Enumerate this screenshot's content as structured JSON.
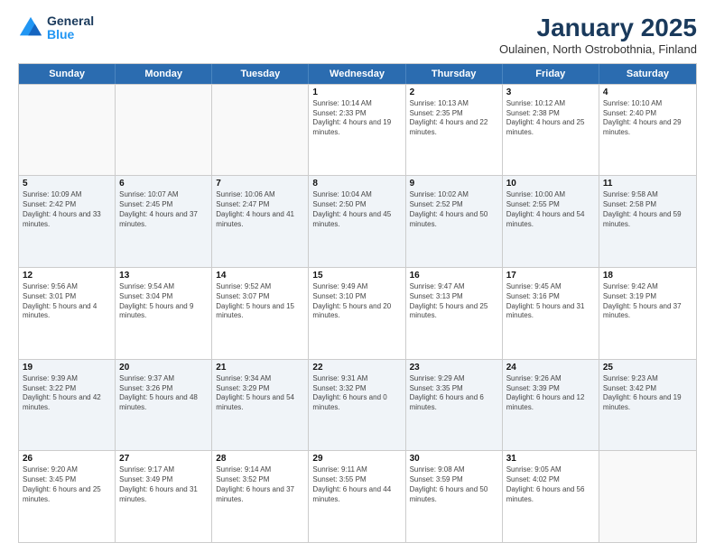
{
  "header": {
    "logo_line1": "General",
    "logo_line2": "Blue",
    "title": "January 2025",
    "subtitle": "Oulainen, North Ostrobothnia, Finland"
  },
  "weekdays": [
    "Sunday",
    "Monday",
    "Tuesday",
    "Wednesday",
    "Thursday",
    "Friday",
    "Saturday"
  ],
  "rows": [
    [
      {
        "day": "",
        "sunrise": "",
        "sunset": "",
        "daylight": "",
        "empty": true
      },
      {
        "day": "",
        "sunrise": "",
        "sunset": "",
        "daylight": "",
        "empty": true
      },
      {
        "day": "",
        "sunrise": "",
        "sunset": "",
        "daylight": "",
        "empty": true
      },
      {
        "day": "1",
        "sunrise": "Sunrise: 10:14 AM",
        "sunset": "Sunset: 2:33 PM",
        "daylight": "Daylight: 4 hours and 19 minutes."
      },
      {
        "day": "2",
        "sunrise": "Sunrise: 10:13 AM",
        "sunset": "Sunset: 2:35 PM",
        "daylight": "Daylight: 4 hours and 22 minutes."
      },
      {
        "day": "3",
        "sunrise": "Sunrise: 10:12 AM",
        "sunset": "Sunset: 2:38 PM",
        "daylight": "Daylight: 4 hours and 25 minutes."
      },
      {
        "day": "4",
        "sunrise": "Sunrise: 10:10 AM",
        "sunset": "Sunset: 2:40 PM",
        "daylight": "Daylight: 4 hours and 29 minutes."
      }
    ],
    [
      {
        "day": "5",
        "sunrise": "Sunrise: 10:09 AM",
        "sunset": "Sunset: 2:42 PM",
        "daylight": "Daylight: 4 hours and 33 minutes."
      },
      {
        "day": "6",
        "sunrise": "Sunrise: 10:07 AM",
        "sunset": "Sunset: 2:45 PM",
        "daylight": "Daylight: 4 hours and 37 minutes."
      },
      {
        "day": "7",
        "sunrise": "Sunrise: 10:06 AM",
        "sunset": "Sunset: 2:47 PM",
        "daylight": "Daylight: 4 hours and 41 minutes."
      },
      {
        "day": "8",
        "sunrise": "Sunrise: 10:04 AM",
        "sunset": "Sunset: 2:50 PM",
        "daylight": "Daylight: 4 hours and 45 minutes."
      },
      {
        "day": "9",
        "sunrise": "Sunrise: 10:02 AM",
        "sunset": "Sunset: 2:52 PM",
        "daylight": "Daylight: 4 hours and 50 minutes."
      },
      {
        "day": "10",
        "sunrise": "Sunrise: 10:00 AM",
        "sunset": "Sunset: 2:55 PM",
        "daylight": "Daylight: 4 hours and 54 minutes."
      },
      {
        "day": "11",
        "sunrise": "Sunrise: 9:58 AM",
        "sunset": "Sunset: 2:58 PM",
        "daylight": "Daylight: 4 hours and 59 minutes."
      }
    ],
    [
      {
        "day": "12",
        "sunrise": "Sunrise: 9:56 AM",
        "sunset": "Sunset: 3:01 PM",
        "daylight": "Daylight: 5 hours and 4 minutes."
      },
      {
        "day": "13",
        "sunrise": "Sunrise: 9:54 AM",
        "sunset": "Sunset: 3:04 PM",
        "daylight": "Daylight: 5 hours and 9 minutes."
      },
      {
        "day": "14",
        "sunrise": "Sunrise: 9:52 AM",
        "sunset": "Sunset: 3:07 PM",
        "daylight": "Daylight: 5 hours and 15 minutes."
      },
      {
        "day": "15",
        "sunrise": "Sunrise: 9:49 AM",
        "sunset": "Sunset: 3:10 PM",
        "daylight": "Daylight: 5 hours and 20 minutes."
      },
      {
        "day": "16",
        "sunrise": "Sunrise: 9:47 AM",
        "sunset": "Sunset: 3:13 PM",
        "daylight": "Daylight: 5 hours and 25 minutes."
      },
      {
        "day": "17",
        "sunrise": "Sunrise: 9:45 AM",
        "sunset": "Sunset: 3:16 PM",
        "daylight": "Daylight: 5 hours and 31 minutes."
      },
      {
        "day": "18",
        "sunrise": "Sunrise: 9:42 AM",
        "sunset": "Sunset: 3:19 PM",
        "daylight": "Daylight: 5 hours and 37 minutes."
      }
    ],
    [
      {
        "day": "19",
        "sunrise": "Sunrise: 9:39 AM",
        "sunset": "Sunset: 3:22 PM",
        "daylight": "Daylight: 5 hours and 42 minutes."
      },
      {
        "day": "20",
        "sunrise": "Sunrise: 9:37 AM",
        "sunset": "Sunset: 3:26 PM",
        "daylight": "Daylight: 5 hours and 48 minutes."
      },
      {
        "day": "21",
        "sunrise": "Sunrise: 9:34 AM",
        "sunset": "Sunset: 3:29 PM",
        "daylight": "Daylight: 5 hours and 54 minutes."
      },
      {
        "day": "22",
        "sunrise": "Sunrise: 9:31 AM",
        "sunset": "Sunset: 3:32 PM",
        "daylight": "Daylight: 6 hours and 0 minutes."
      },
      {
        "day": "23",
        "sunrise": "Sunrise: 9:29 AM",
        "sunset": "Sunset: 3:35 PM",
        "daylight": "Daylight: 6 hours and 6 minutes."
      },
      {
        "day": "24",
        "sunrise": "Sunrise: 9:26 AM",
        "sunset": "Sunset: 3:39 PM",
        "daylight": "Daylight: 6 hours and 12 minutes."
      },
      {
        "day": "25",
        "sunrise": "Sunrise: 9:23 AM",
        "sunset": "Sunset: 3:42 PM",
        "daylight": "Daylight: 6 hours and 19 minutes."
      }
    ],
    [
      {
        "day": "26",
        "sunrise": "Sunrise: 9:20 AM",
        "sunset": "Sunset: 3:45 PM",
        "daylight": "Daylight: 6 hours and 25 minutes."
      },
      {
        "day": "27",
        "sunrise": "Sunrise: 9:17 AM",
        "sunset": "Sunset: 3:49 PM",
        "daylight": "Daylight: 6 hours and 31 minutes."
      },
      {
        "day": "28",
        "sunrise": "Sunrise: 9:14 AM",
        "sunset": "Sunset: 3:52 PM",
        "daylight": "Daylight: 6 hours and 37 minutes."
      },
      {
        "day": "29",
        "sunrise": "Sunrise: 9:11 AM",
        "sunset": "Sunset: 3:55 PM",
        "daylight": "Daylight: 6 hours and 44 minutes."
      },
      {
        "day": "30",
        "sunrise": "Sunrise: 9:08 AM",
        "sunset": "Sunset: 3:59 PM",
        "daylight": "Daylight: 6 hours and 50 minutes."
      },
      {
        "day": "31",
        "sunrise": "Sunrise: 9:05 AM",
        "sunset": "Sunset: 4:02 PM",
        "daylight": "Daylight: 6 hours and 56 minutes."
      },
      {
        "day": "",
        "sunrise": "",
        "sunset": "",
        "daylight": "",
        "empty": true
      }
    ]
  ]
}
